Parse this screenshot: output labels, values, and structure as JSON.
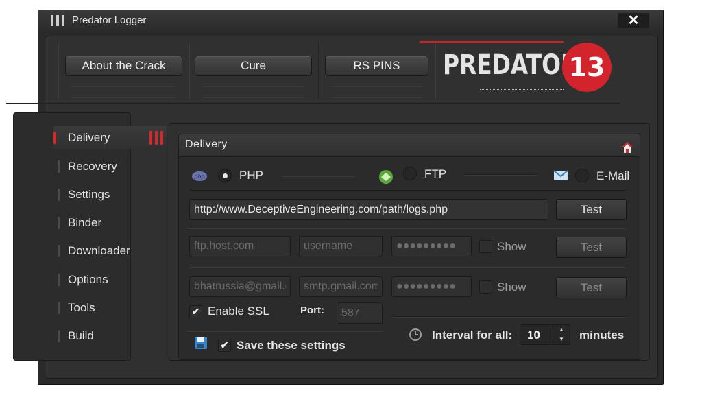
{
  "window": {
    "title": "Predator Logger",
    "close": "✕"
  },
  "top_buttons": [
    "About the Crack",
    "Cure",
    "RS PINS"
  ],
  "logo": {
    "text": "PREDATOR",
    "number": "13",
    "accent": "#d3232c"
  },
  "sidebar": {
    "items": [
      {
        "label": "Delivery",
        "active": true
      },
      {
        "label": "Recovery"
      },
      {
        "label": "Settings"
      },
      {
        "label": "Binder"
      },
      {
        "label": "Downloader"
      },
      {
        "label": "Options"
      },
      {
        "label": "Tools"
      },
      {
        "label": "Build"
      }
    ]
  },
  "panel": {
    "title": "Delivery",
    "methods": [
      {
        "label": "PHP",
        "icon": "php-icon",
        "selected": true
      },
      {
        "label": "FTP",
        "icon": "ftp-icon",
        "selected": false
      },
      {
        "label": "E-Mail",
        "icon": "mail-icon",
        "selected": false
      }
    ],
    "php_url": "http://www.DeceptiveEngineering.com/path/logs.php",
    "ftp": {
      "host": "ftp.host.com",
      "username": "username",
      "password": "●●●●●●●●●"
    },
    "email": {
      "address": "bhatrussia@gmail.c",
      "smtp": "smtp.gmail.com",
      "password": "●●●●●●●●●"
    },
    "show_label": "Show",
    "test_label": "Test",
    "ssl_label": "Enable SSL",
    "port_label": "Port:",
    "port_value": "587",
    "save_label": "Save these settings",
    "interval_label": "Interval for all:",
    "interval_value": "10",
    "interval_unit": "minutes",
    "check": "✔"
  }
}
